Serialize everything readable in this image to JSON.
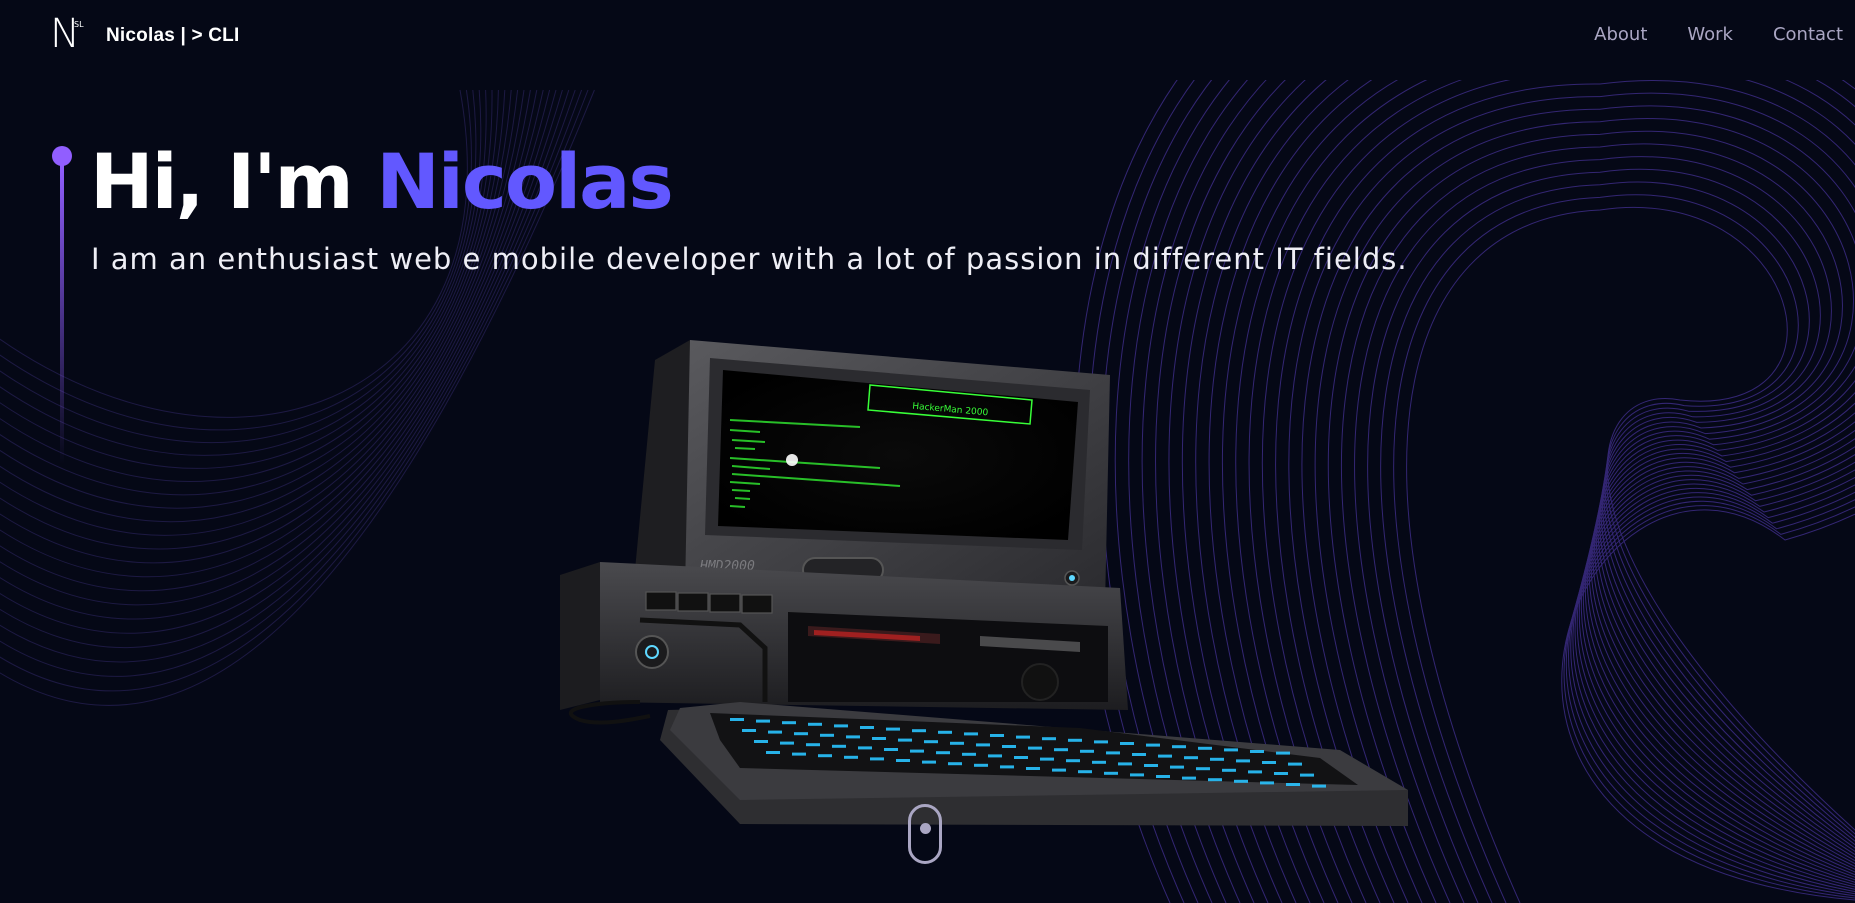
{
  "nav": {
    "logo_letter": "N",
    "logo_side": "SL",
    "logo_text": "Nicolas | > CLI",
    "links": [
      "About",
      "Work",
      "Contact"
    ]
  },
  "hero": {
    "greeting": "Hi, I'm ",
    "name": "Nicolas",
    "subtitle": "I am an enthusiast web e mobile developer with a lot of passion in different IT fields."
  },
  "computer": {
    "screen_title": "HackerMan 2000",
    "brand": "HMD2000"
  },
  "colors": {
    "background": "#050816",
    "accent": "#915eff",
    "name": "#6258ff",
    "nav_text": "#aaa6c3"
  }
}
